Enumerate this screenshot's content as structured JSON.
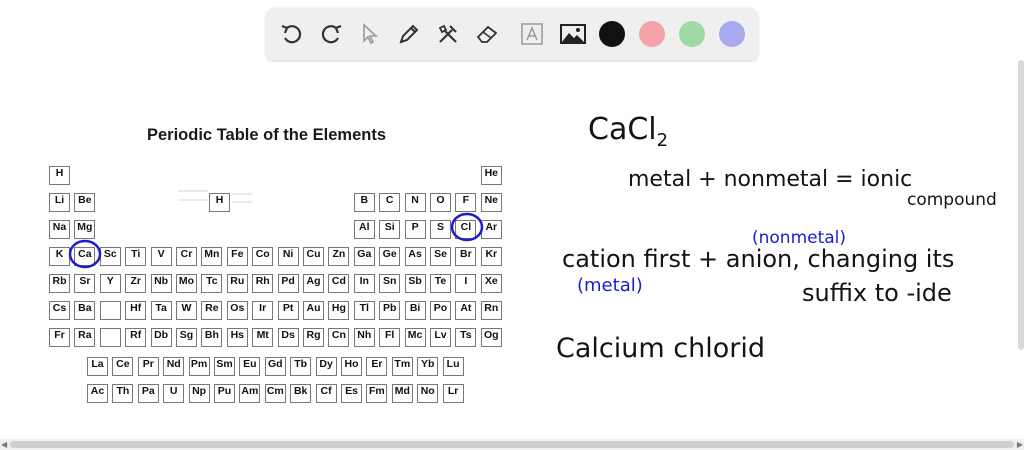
{
  "toolbar": {
    "tools": [
      {
        "name": "undo-icon"
      },
      {
        "name": "redo-icon"
      },
      {
        "name": "pointer-icon"
      },
      {
        "name": "pen-icon"
      },
      {
        "name": "tools-icon"
      },
      {
        "name": "eraser-icon"
      },
      {
        "name": "text-icon"
      },
      {
        "name": "image-icon"
      }
    ],
    "colors": [
      "#111111",
      "#f2a2a8",
      "#9fd9a5",
      "#a9a9ee"
    ]
  },
  "periodic_table": {
    "title": "Periodic Table of the Elements",
    "main_rows": [
      [
        "H",
        "",
        "",
        "",
        "",
        "",
        "",
        "",
        "",
        "",
        "",
        "",
        "",
        "",
        "",
        "",
        "",
        "He"
      ],
      [
        "Li",
        "Be",
        "",
        "",
        "",
        "",
        "",
        "",
        "",
        "",
        "",
        "",
        "B",
        "C",
        "N",
        "O",
        "F",
        "Ne"
      ],
      [
        "Na",
        "Mg",
        "",
        "",
        "",
        "",
        "",
        "",
        "",
        "",
        "",
        "",
        "Al",
        "Si",
        "P",
        "S",
        "Cl",
        "Ar"
      ],
      [
        "K",
        "Ca",
        "Sc",
        "Ti",
        "V",
        "Cr",
        "Mn",
        "Fe",
        "Co",
        "Ni",
        "Cu",
        "Zn",
        "Ga",
        "Ge",
        "As",
        "Se",
        "Br",
        "Kr"
      ],
      [
        "Rb",
        "Sr",
        "Y",
        "Zr",
        "Nb",
        "Mo",
        "Tc",
        "Ru",
        "Rh",
        "Pd",
        "Ag",
        "Cd",
        "In",
        "Sn",
        "Sb",
        "Te",
        "I",
        "Xe"
      ],
      [
        "Cs",
        "Ba",
        "",
        "Hf",
        "Ta",
        "W",
        "Re",
        "Os",
        "Ir",
        "Pt",
        "Au",
        "Hg",
        "Tl",
        "Pb",
        "Bi",
        "Po",
        "At",
        "Rn"
      ],
      [
        "Fr",
        "Ra",
        "",
        "Rf",
        "Db",
        "Sg",
        "Bh",
        "Hs",
        "Mt",
        "Ds",
        "Rg",
        "Cn",
        "Nh",
        "Fl",
        "Mc",
        "Lv",
        "Ts",
        "Og"
      ]
    ],
    "lanthanides": [
      "La",
      "Ce",
      "Pr",
      "Nd",
      "Pm",
      "Sm",
      "Eu",
      "Gd",
      "Tb",
      "Dy",
      "Ho",
      "Er",
      "Tm",
      "Yb",
      "Lu"
    ],
    "actinides": [
      "Ac",
      "Th",
      "Pa",
      "U",
      "Np",
      "Pu",
      "Am",
      "Cm",
      "Bk",
      "Cf",
      "Es",
      "Fm",
      "Md",
      "No",
      "Lr"
    ],
    "key_symbol": "H"
  },
  "notes": {
    "formula_main": "CaCl",
    "formula_sub": "2",
    "rule1_line1": "metal + nonmetal = ionic",
    "rule1_line2": "compound",
    "rule2_tag_top": "(nonmetal)",
    "rule2_line1": "cation first + anion, changing its",
    "rule2_tag_left": "(metal)",
    "rule2_line2": "suffix to -ide",
    "answer": "Calcium chlorid"
  }
}
